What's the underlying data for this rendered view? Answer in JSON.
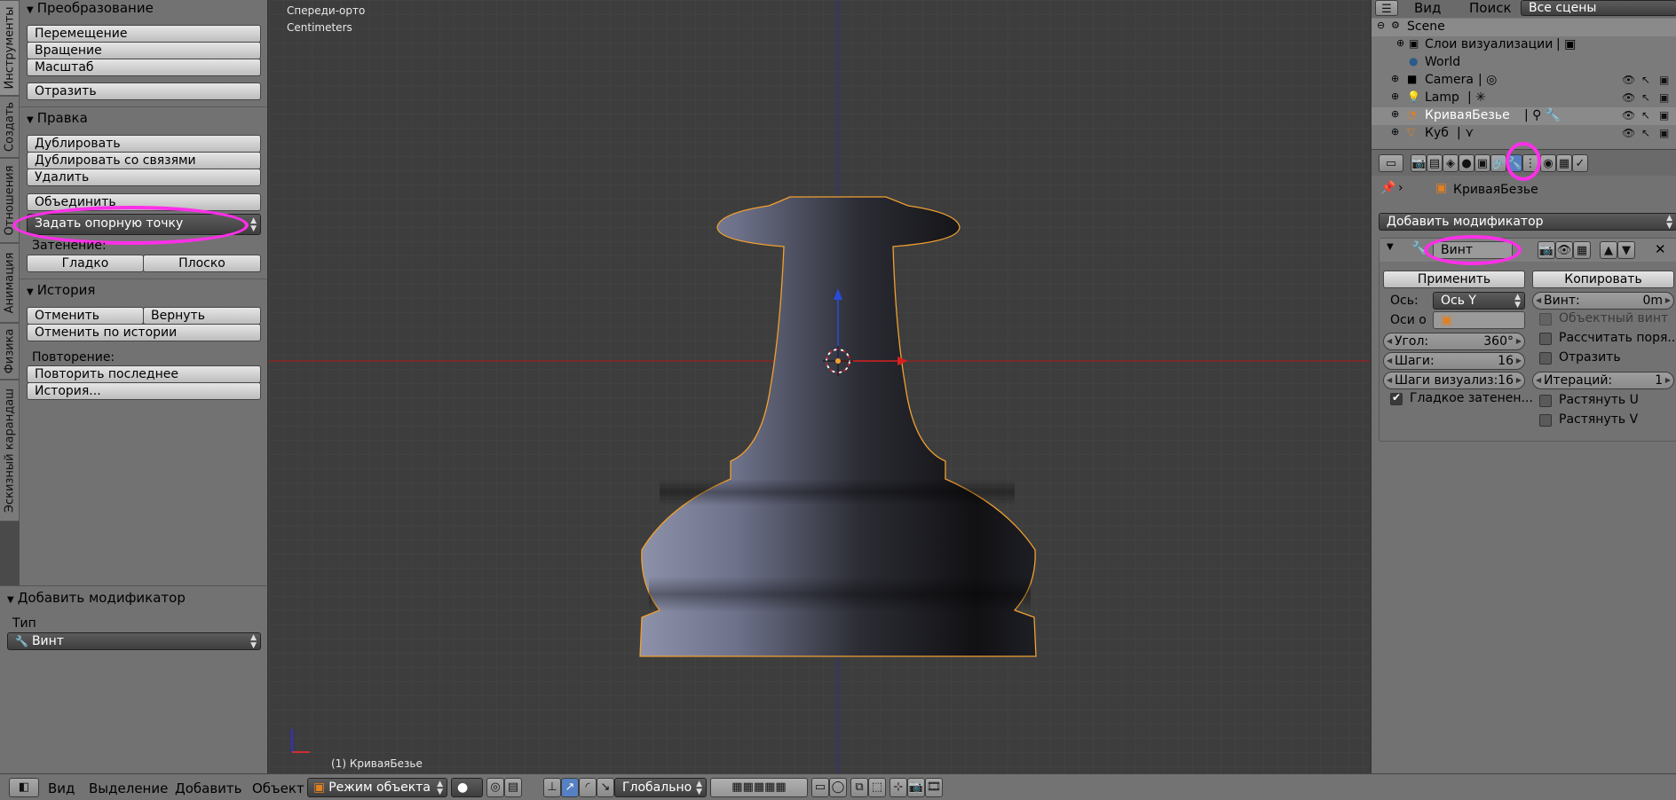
{
  "colors": {
    "highlight": "#ff2fe8",
    "viewport_bg": "#3d3d3d",
    "panel_bg": "#727272",
    "object_outline": "#f0a030"
  },
  "left_tabs": [
    "Инструменты",
    "Создать",
    "Отношения",
    "Анимация",
    "Физика",
    "Эскизный карандаш"
  ],
  "transform": {
    "header": "Преобразование",
    "move": "Перемещение",
    "rotate": "Вращение",
    "scale": "Масштаб",
    "mirror": "Отразить"
  },
  "edit": {
    "header": "Правка",
    "duplicate": "Дублировать",
    "duplicate_linked": "Дублировать со связями",
    "delete": "Удалить",
    "join": "Объединить",
    "set_origin": "Задать опорную точку",
    "shading_label": "Затенение:",
    "smooth": "Гладко",
    "flat": "Плоско"
  },
  "history": {
    "header": "История",
    "undo": "Отменить",
    "redo": "Вернуть",
    "undo_history": "Отменить по истории",
    "repeat_label": "Повторение:",
    "repeat_last": "Повторить последнее",
    "history_menu": "История..."
  },
  "operator": {
    "header": "Добавить модификатор",
    "type_label": "Тип",
    "type_value": "Винт"
  },
  "viewport": {
    "view_name": "Спереди-орто",
    "units": "Centimeters",
    "object_label": "(1) КриваяБезье"
  },
  "outliner": {
    "tabs": [
      "Вид",
      "Поиск",
      "Все сцены"
    ],
    "items": [
      {
        "name": "Scene"
      },
      {
        "name": "Слои визуализации"
      },
      {
        "name": "World"
      },
      {
        "name": "Camera"
      },
      {
        "name": "Lamp"
      },
      {
        "name": "КриваяБезье"
      },
      {
        "name": "Куб"
      }
    ]
  },
  "properties": {
    "object_name": "КриваяБезье",
    "add_modifier": "Добавить модификатор",
    "modifier_name": "Винт",
    "apply": "Применить",
    "copy": "Копировать",
    "axis_label": "Ось:",
    "axis_value": "Ось Y",
    "axis_object_label": "Оси о",
    "screw_label": "Винт:",
    "screw_value": "0m",
    "object_screw": "Объектный винт",
    "calc_order": "Рассчитать поря...",
    "flip": "Отразить",
    "angle_label": "Угол:",
    "angle_value": "360°",
    "steps_label": "Шаги:",
    "steps_value": "16",
    "render_steps_label": "Шаги визуализ:",
    "render_steps_value": "16",
    "iterations_label": "Итераций:",
    "iterations_value": "1",
    "smooth_shading": "Гладкое затенен...",
    "stretch_u": "Растянуть U",
    "stretch_v": "Растянуть V"
  },
  "bottombar": {
    "view": "Вид",
    "select": "Выделение",
    "add": "Добавить",
    "object": "Объект",
    "mode": "Режим объекта",
    "orientation": "Глобально"
  }
}
